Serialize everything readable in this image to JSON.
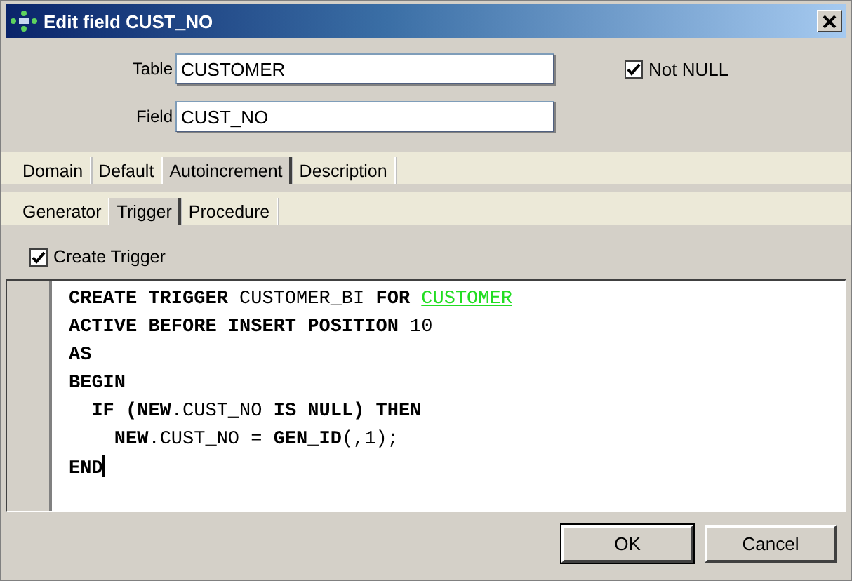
{
  "window": {
    "title": "Edit field CUST_NO"
  },
  "form": {
    "table_label": "Table",
    "table_value": "CUSTOMER",
    "field_label": "Field",
    "field_value": "CUST_NO",
    "not_null": {
      "label": "Not NULL",
      "checked": true
    }
  },
  "tabs": [
    {
      "label": "Domain",
      "selected": false
    },
    {
      "label": "Default",
      "selected": false
    },
    {
      "label": "Autoincrement",
      "selected": true
    },
    {
      "label": "Description",
      "selected": false
    }
  ],
  "subtabs": [
    {
      "label": "Generator",
      "selected": false
    },
    {
      "label": "Trigger",
      "selected": true
    },
    {
      "label": "Procedure",
      "selected": false
    }
  ],
  "create_trigger": {
    "label": "Create Trigger",
    "checked": true
  },
  "code": [
    {
      "segments": [
        {
          "text": "CREATE TRIGGER",
          "kind": "keyword"
        },
        {
          "text": " CUSTOMER_BI ",
          "kind": "plain"
        },
        {
          "text": "FOR ",
          "kind": "keyword"
        },
        {
          "text": "CUSTOMER",
          "kind": "link"
        }
      ]
    },
    {
      "segments": [
        {
          "text": "ACTIVE BEFORE INSERT POSITION",
          "kind": "keyword"
        },
        {
          "text": " 10",
          "kind": "plain"
        }
      ]
    },
    {
      "segments": [
        {
          "text": "AS",
          "kind": "keyword"
        }
      ]
    },
    {
      "segments": [
        {
          "text": "BEGIN",
          "kind": "keyword"
        }
      ]
    },
    {
      "segments": [
        {
          "text": "  IF (NEW",
          "kind": "keyword"
        },
        {
          "text": ".CUST_NO ",
          "kind": "plain"
        },
        {
          "text": "IS NULL) THEN",
          "kind": "keyword"
        }
      ]
    },
    {
      "segments": [
        {
          "text": "    NEW",
          "kind": "keyword"
        },
        {
          "text": ".CUST_NO = ",
          "kind": "plain"
        },
        {
          "text": "GEN_ID",
          "kind": "keyword"
        },
        {
          "text": "(,1);",
          "kind": "plain"
        }
      ]
    },
    {
      "segments": [
        {
          "text": "END",
          "kind": "keyword"
        }
      ],
      "cursor": true
    }
  ],
  "buttons": [
    {
      "label": "OK",
      "default": true
    },
    {
      "label": "Cancel",
      "default": false
    }
  ]
}
